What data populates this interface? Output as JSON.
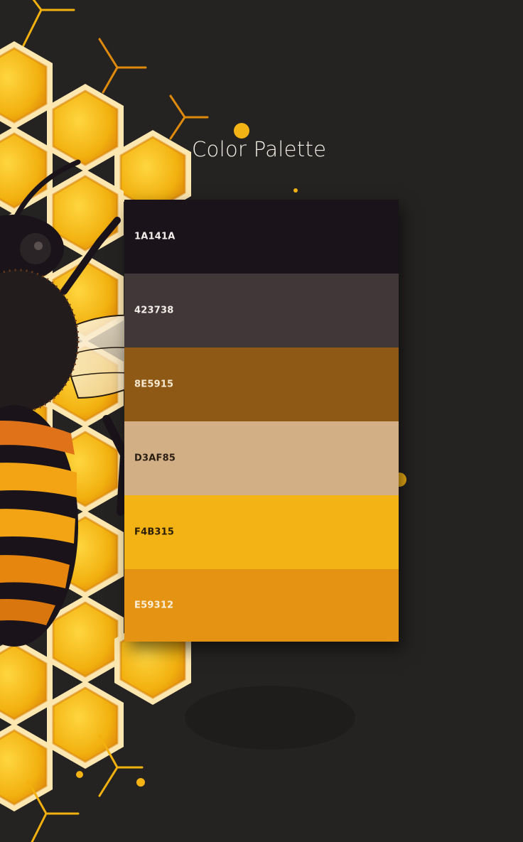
{
  "title": "Color Palette",
  "palette": {
    "swatches": [
      {
        "code": "1A141A",
        "color": "#1A141A",
        "text_color": "#f2eee9"
      },
      {
        "code": "423738",
        "color": "#423738",
        "text_color": "#f2eee9"
      },
      {
        "code": "8E5915",
        "color": "#8E5915",
        "text_color": "#f6ead3"
      },
      {
        "code": "D3AF85",
        "color": "#D3AF85",
        "text_color": "#2a1e12"
      },
      {
        "code": "F4B315",
        "color": "#F4B315",
        "text_color": "#2a1e08"
      },
      {
        "code": "E59312",
        "color": "#E59312",
        "text_color": "#fbf0dc"
      }
    ]
  },
  "background": {
    "color": "#242322",
    "illustration": "honeybee-on-honeycomb-illustration"
  }
}
